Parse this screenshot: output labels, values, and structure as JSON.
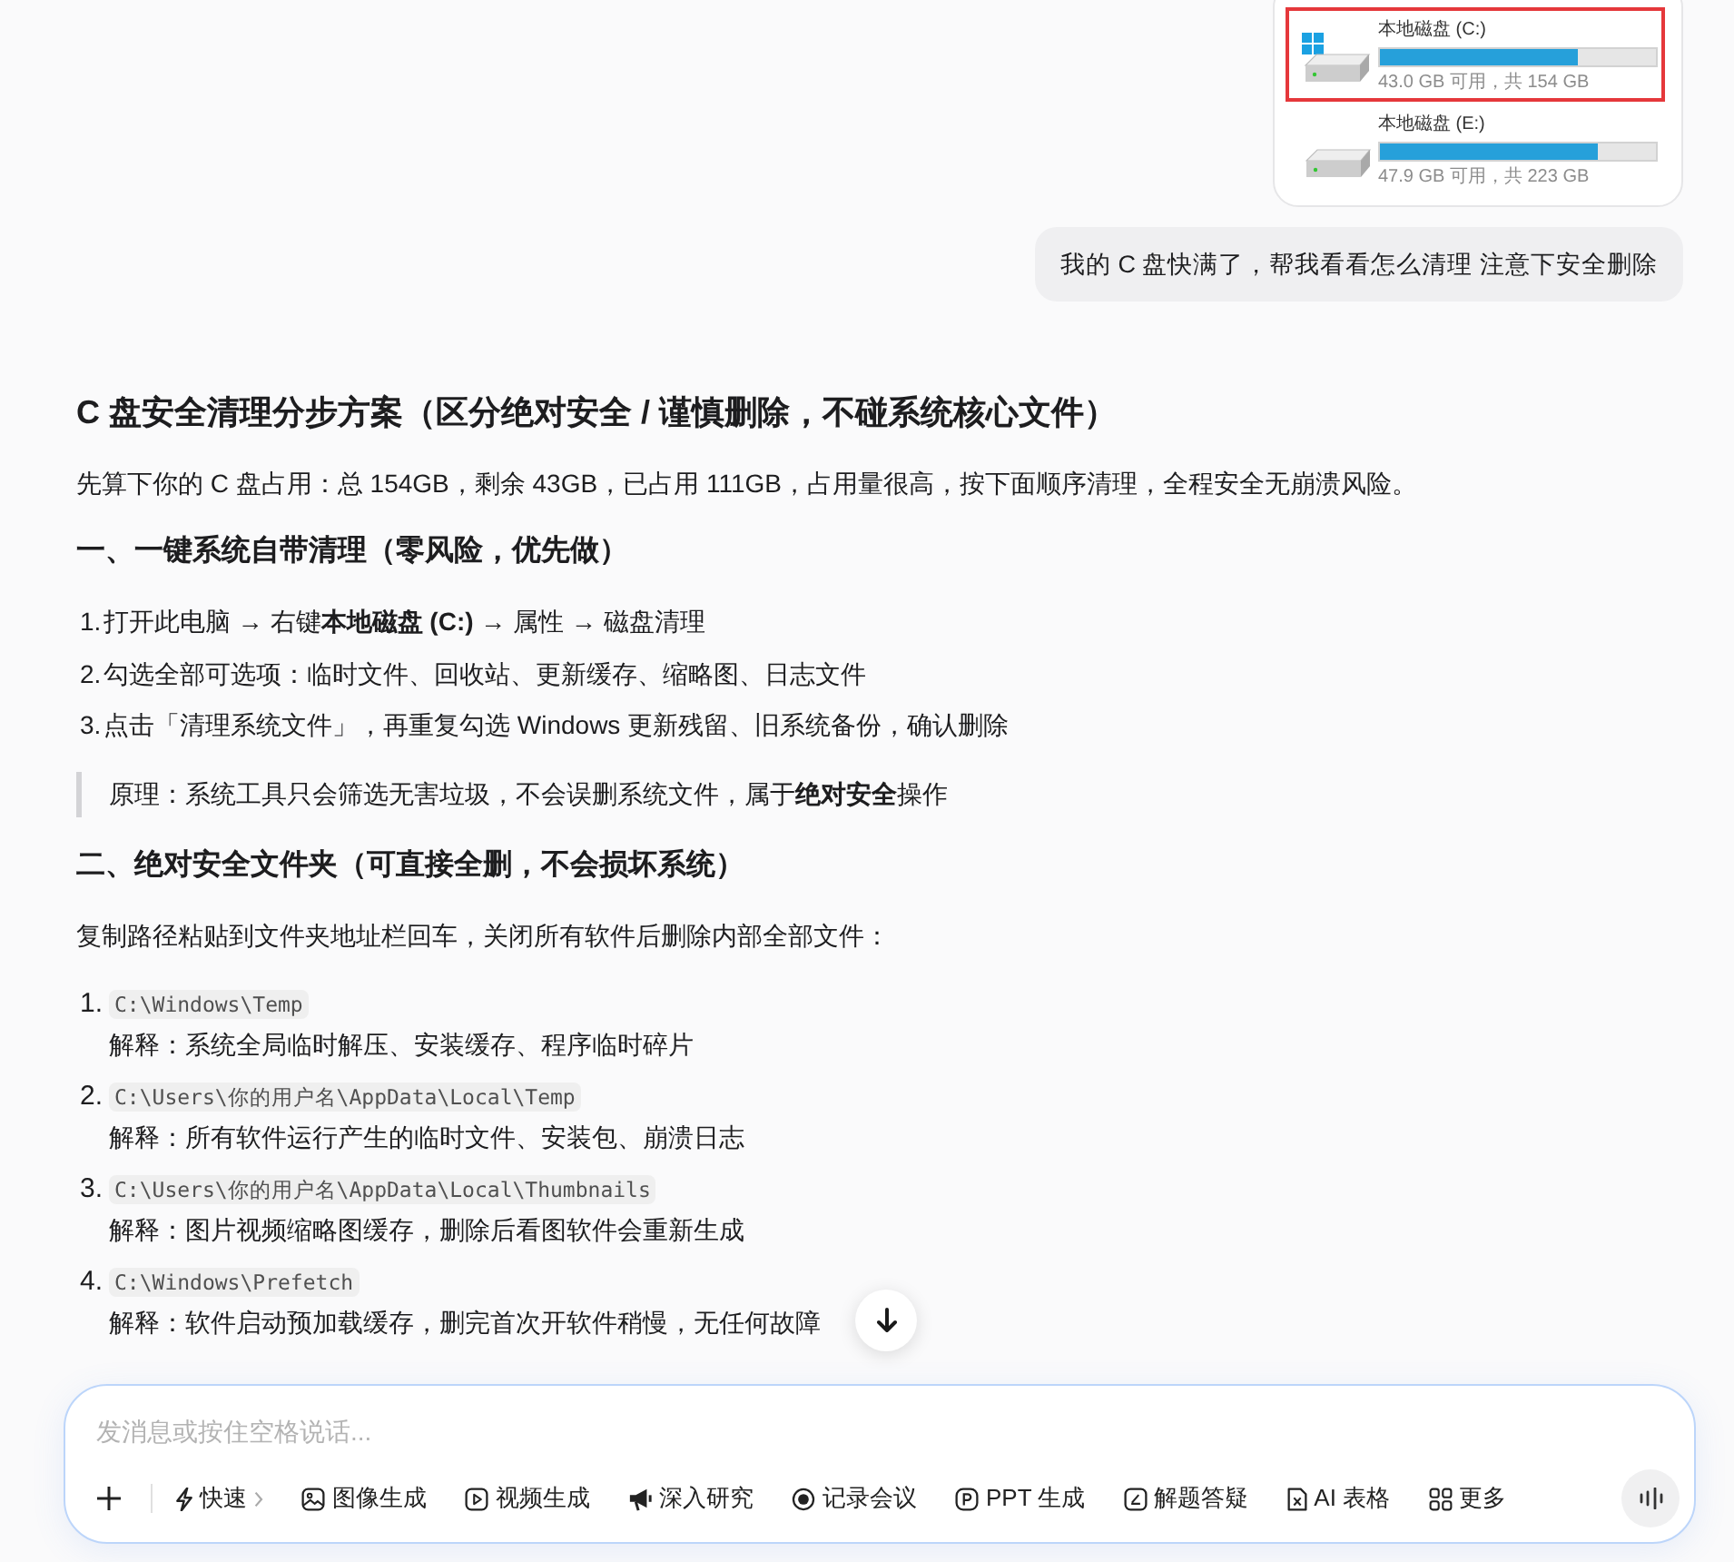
{
  "attachment": {
    "drives": [
      {
        "kind": "system",
        "label": "本地磁盘 (C:)",
        "level": 0.72,
        "reading": "43.0 GB 可用，共 154 GB",
        "highlighted": true
      },
      {
        "kind": "data",
        "label": "本地磁盘 (E:)",
        "level": 0.79,
        "reading": "47.9 GB 可用，共 223 GB",
        "highlighted": false
      }
    ]
  },
  "user_message": {
    "text": "我的 C 盘快满了，帮我看看怎么清理 注意下安全删除"
  },
  "answer": [
    {
      "kind": "title",
      "text": "C 盘安全清理分步方案（区分绝对安全 / 谨慎删除，不碰系统核心文件）"
    },
    {
      "kind": "paragraph",
      "text": "先算下你的 C 盘占用：总 154GB，剩余 43GB，已占用 111GB，占用量很高，按下面顺序清理，全程安全无崩溃风险。"
    },
    {
      "kind": "heading",
      "text": "一、一键系统自带清理（零风险，优先做）"
    },
    {
      "kind": "steps",
      "items": [
        {
          "number": "1.",
          "text": "打开此电脑 → 右键**本地磁盘 (C:)** → 属性 → 磁盘清理"
        },
        {
          "number": "2.",
          "text": "勾选全部可选项：临时文件、回收站、更新缓存、缩略图、日志文件"
        },
        {
          "number": "3.",
          "text": "点击「清理系统文件」，再重复勾选 Windows 更新残留、旧系统备份，确认删除"
        }
      ]
    },
    {
      "kind": "quote",
      "text": "原理：系统工具只会筛选无害垃圾，不会误删系统文件，属于**绝对安全**操作"
    },
    {
      "kind": "heading",
      "text": "二、绝对安全文件夹（可直接全删，不会损坏系统）"
    },
    {
      "kind": "paragraph",
      "text": "复制路径粘贴到文件夹地址栏回车，关闭所有软件后删除内部全部文件："
    },
    {
      "kind": "paths",
      "items": [
        {
          "number": "1.",
          "path": "C:\\Windows\\Temp",
          "note": "解释：系统全局临时解压、安装缓存、程序临时碎片"
        },
        {
          "number": "2.",
          "path": "C:\\Users\\你的用户名\\AppData\\Local\\Temp",
          "note": "解释：所有软件运行产生的临时文件、安装包、崩溃日志"
        },
        {
          "number": "3.",
          "path": "C:\\Users\\你的用户名\\AppData\\Local\\Thumbnails",
          "note": "解释：图片视频缩略图缓存，删除后看图软件会重新生成"
        },
        {
          "number": "4.",
          "path": "C:\\Windows\\Prefetch",
          "note": "解释：软件启动预加载缓存，删完首次开软件稍慢，无任何故障"
        }
      ]
    }
  ],
  "composer": {
    "placeholder": "发消息或按住空格说话...",
    "tools": [
      {
        "kind": "dropdown",
        "label": "快速"
      },
      {
        "kind": "tool",
        "label": "图像生成"
      },
      {
        "kind": "tool",
        "label": "视频生成"
      },
      {
        "kind": "tool",
        "label": "深入研究"
      },
      {
        "kind": "tool",
        "label": "记录会议"
      },
      {
        "kind": "tool",
        "label": "PPT 生成"
      },
      {
        "kind": "tool",
        "label": "解题答疑"
      },
      {
        "kind": "tool",
        "label": "AI 表格"
      },
      {
        "kind": "tool",
        "label": "更多"
      }
    ]
  }
}
